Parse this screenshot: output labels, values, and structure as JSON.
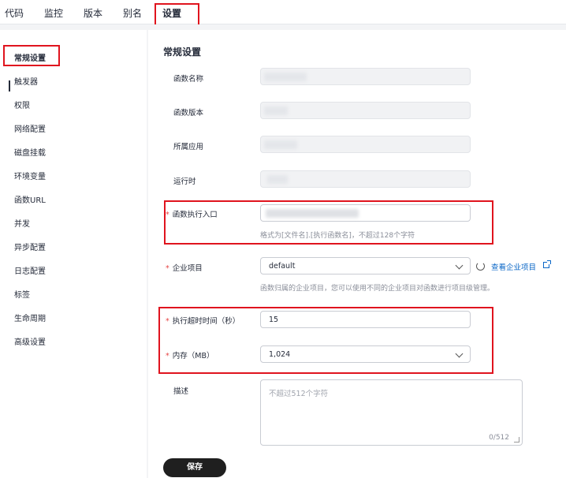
{
  "tabs": [
    "代码",
    "监控",
    "版本",
    "别名",
    "设置"
  ],
  "sidebar": {
    "items": [
      "常规设置",
      "触发器",
      "权限",
      "网络配置",
      "磁盘挂载",
      "环境变量",
      "函数URL",
      "并发",
      "异步配置",
      "日志配置",
      "标签",
      "生命周期",
      "高级设置"
    ]
  },
  "form": {
    "title": "常规设置",
    "function_name_label": "函数名称",
    "function_version_label": "函数版本",
    "app_label": "所属应用",
    "runtime_label": "运行时",
    "handler_label": "函数执行入口",
    "handler_hint": "格式为[文件名].[执行函数名]，不超过128个字符",
    "project_label": "企业项目",
    "project_value": "default",
    "project_link": "查看企业项目",
    "project_hint": "函数归属的企业项目，您可以使用不同的企业项目对函数进行项目级管理。",
    "timeout_label": "执行超时时间（秒）",
    "timeout_value": "15",
    "memory_label": "内存（MB）",
    "memory_value": "1,024",
    "desc_label": "描述",
    "desc_placeholder": "不超过512个字符",
    "desc_counter": "0/512",
    "save": "保存"
  }
}
